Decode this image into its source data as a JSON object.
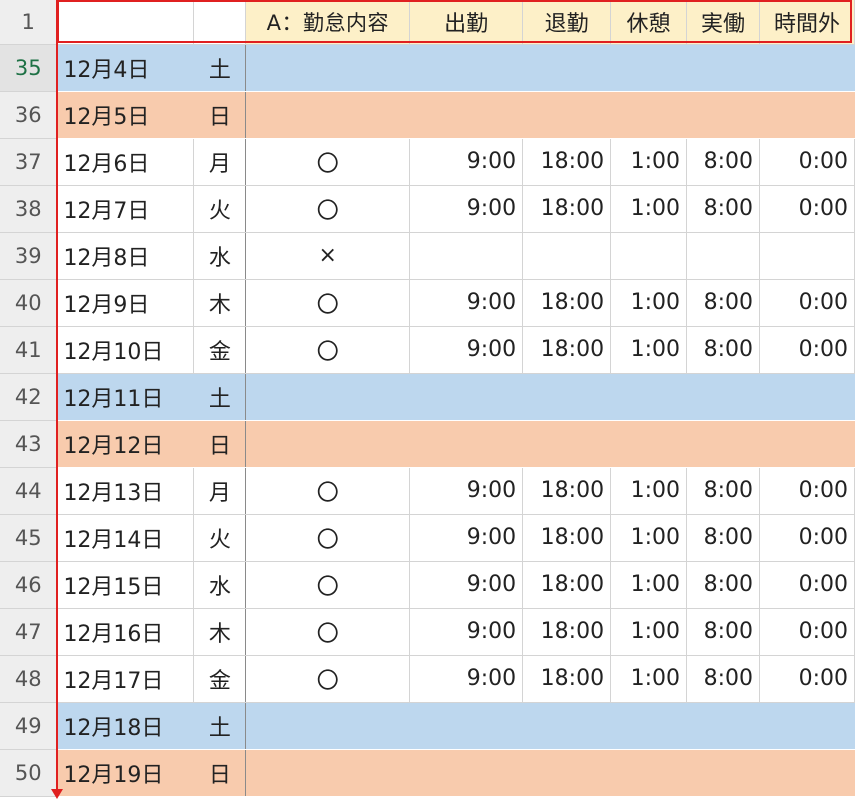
{
  "header": {
    "row_number": "1",
    "col_a_title": "A：勤怠内容",
    "col_clock_in": "出勤",
    "col_clock_out": "退勤",
    "col_break": "休憩",
    "col_actual": "実働",
    "col_overtime": "時間外"
  },
  "rows": [
    {
      "n": "35",
      "date": "12月4日",
      "day": "土",
      "type": "sat",
      "status": "",
      "in": "",
      "out": "",
      "break": "",
      "actual": "",
      "ot": ""
    },
    {
      "n": "36",
      "date": "12月5日",
      "day": "日",
      "type": "sun",
      "status": "",
      "in": "",
      "out": "",
      "break": "",
      "actual": "",
      "ot": ""
    },
    {
      "n": "37",
      "date": "12月6日",
      "day": "月",
      "type": "work",
      "status": "〇",
      "in": "9:00",
      "out": "18:00",
      "break": "1:00",
      "actual": "8:00",
      "ot": "0:00"
    },
    {
      "n": "38",
      "date": "12月7日",
      "day": "火",
      "type": "work",
      "status": "〇",
      "in": "9:00",
      "out": "18:00",
      "break": "1:00",
      "actual": "8:00",
      "ot": "0:00"
    },
    {
      "n": "39",
      "date": "12月8日",
      "day": "水",
      "type": "work",
      "status": "×",
      "in": "",
      "out": "",
      "break": "",
      "actual": "",
      "ot": ""
    },
    {
      "n": "40",
      "date": "12月9日",
      "day": "木",
      "type": "work",
      "status": "〇",
      "in": "9:00",
      "out": "18:00",
      "break": "1:00",
      "actual": "8:00",
      "ot": "0:00"
    },
    {
      "n": "41",
      "date": "12月10日",
      "day": "金",
      "type": "work",
      "status": "〇",
      "in": "9:00",
      "out": "18:00",
      "break": "1:00",
      "actual": "8:00",
      "ot": "0:00"
    },
    {
      "n": "42",
      "date": "12月11日",
      "day": "土",
      "type": "sat",
      "status": "",
      "in": "",
      "out": "",
      "break": "",
      "actual": "",
      "ot": ""
    },
    {
      "n": "43",
      "date": "12月12日",
      "day": "日",
      "type": "sun",
      "status": "",
      "in": "",
      "out": "",
      "break": "",
      "actual": "",
      "ot": ""
    },
    {
      "n": "44",
      "date": "12月13日",
      "day": "月",
      "type": "work",
      "status": "〇",
      "in": "9:00",
      "out": "18:00",
      "break": "1:00",
      "actual": "8:00",
      "ot": "0:00"
    },
    {
      "n": "45",
      "date": "12月14日",
      "day": "火",
      "type": "work",
      "status": "〇",
      "in": "9:00",
      "out": "18:00",
      "break": "1:00",
      "actual": "8:00",
      "ot": "0:00"
    },
    {
      "n": "46",
      "date": "12月15日",
      "day": "水",
      "type": "work",
      "status": "〇",
      "in": "9:00",
      "out": "18:00",
      "break": "1:00",
      "actual": "8:00",
      "ot": "0:00"
    },
    {
      "n": "47",
      "date": "12月16日",
      "day": "木",
      "type": "work",
      "status": "〇",
      "in": "9:00",
      "out": "18:00",
      "break": "1:00",
      "actual": "8:00",
      "ot": "0:00"
    },
    {
      "n": "48",
      "date": "12月17日",
      "day": "金",
      "type": "work",
      "status": "〇",
      "in": "9:00",
      "out": "18:00",
      "break": "1:00",
      "actual": "8:00",
      "ot": "0:00"
    },
    {
      "n": "49",
      "date": "12月18日",
      "day": "土",
      "type": "sat",
      "status": "",
      "in": "",
      "out": "",
      "break": "",
      "actual": "",
      "ot": ""
    },
    {
      "n": "50",
      "date": "12月19日",
      "day": "日",
      "type": "sun",
      "status": "",
      "in": "",
      "out": "",
      "break": "",
      "actual": "",
      "ot": ""
    }
  ],
  "selected_row_number": "35",
  "colors": {
    "saturday_fill": "#bdd7ee",
    "sunday_fill": "#f8cbad",
    "header_fill": "#fdf0c8",
    "highlight_border": "#e02020"
  }
}
